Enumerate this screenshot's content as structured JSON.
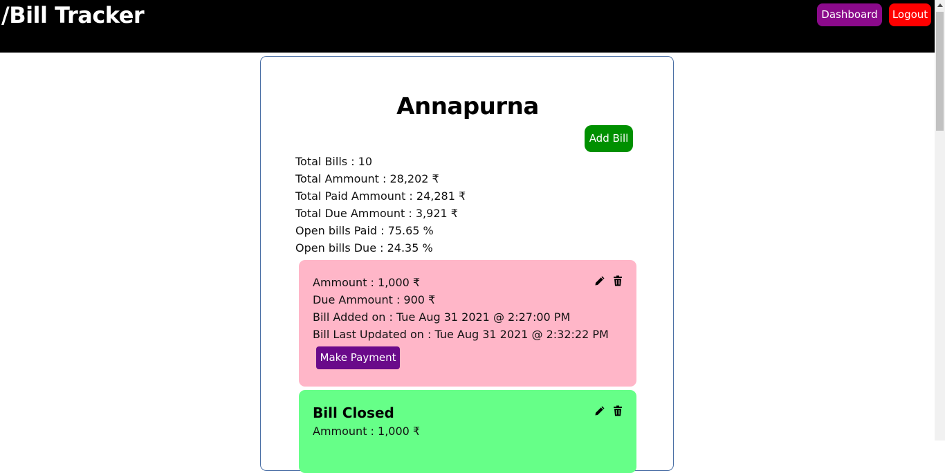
{
  "app": {
    "brand": "/Bill Tracker",
    "nav": {
      "dashboard": "Dashboard",
      "logout": "Logout"
    }
  },
  "colors": {
    "navbar": "#000000",
    "dashboard_button": "#8b0a8b",
    "logout_button": "#ff0000",
    "add_bill_button": "#009000",
    "open_bill_card": "#ffb6c8",
    "closed_bill_card": "#66ff88",
    "make_payment_button": "#6a0a8a"
  },
  "vendor": {
    "name": "Annapurna",
    "add_bill_label": "Add Bill",
    "stats": [
      "Total Bills : 10",
      "Total Ammount : 28,202 ₹",
      "Total Paid Ammount : 24,281 ₹",
      "Total Due Ammount : 3,921 ₹",
      "Open bills Paid : 75.65 %",
      "Open bills Due : 24.35 %"
    ]
  },
  "bills": [
    {
      "status": "open",
      "lines": [
        "Ammount : 1,000 ₹",
        "Due Ammount : 900 ₹",
        "Bill Added on : Tue Aug 31 2021 @ 2:27:00 PM",
        "Bill Last Updated on : Tue Aug 31 2021 @ 2:32:22 PM"
      ],
      "action_label": "Make Payment",
      "icons": [
        "pencil-icon",
        "trash-icon"
      ]
    },
    {
      "status": "closed",
      "heading": "Bill Closed",
      "lines": [
        "Ammount : 1,000 ₹"
      ],
      "icons": [
        "pencil-icon",
        "trash-icon"
      ]
    }
  ]
}
